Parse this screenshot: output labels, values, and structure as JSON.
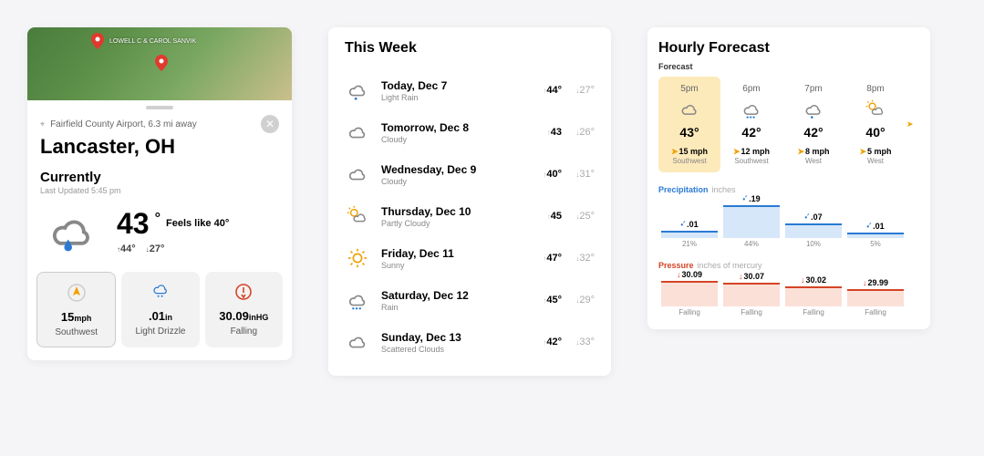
{
  "current": {
    "map_label": "LOWELL C\n& CAROL\nSANVIK",
    "station": "Fairfield County Airport, 6.3 mi away",
    "location": "Lancaster, OH",
    "section": "Currently",
    "updated": "Last Updated 5:45 pm",
    "temp": "43",
    "feels": "Feels like 40°",
    "hi": "44°",
    "lo": "27°",
    "stats": [
      {
        "value": "15",
        "unit": "mph",
        "label": "Southwest",
        "icon": "wind-arrow"
      },
      {
        "value": ".01",
        "unit": "in",
        "label": "Light Drizzle",
        "icon": "rain-cloud"
      },
      {
        "value": "30.09",
        "unit": "inHG",
        "label": "Falling",
        "icon": "pressure"
      }
    ]
  },
  "week": {
    "title": "This Week",
    "days": [
      {
        "name": "Today, Dec 7",
        "cond": "Light Rain",
        "hi": "44°",
        "lo": "27°",
        "icon": "rain-light"
      },
      {
        "name": "Tomorrow, Dec 8",
        "cond": "Cloudy",
        "hi": "43",
        "lo": "26°",
        "icon": "cloudy"
      },
      {
        "name": "Wednesday, Dec 9",
        "cond": "Cloudy",
        "hi": "40°",
        "lo": "31°",
        "icon": "cloudy"
      },
      {
        "name": "Thursday, Dec 10",
        "cond": "Partly Cloudy",
        "hi": "45",
        "lo": "25°",
        "icon": "partly"
      },
      {
        "name": "Friday, Dec 11",
        "cond": "Sunny",
        "hi": "47°",
        "lo": "32°",
        "icon": "sunny"
      },
      {
        "name": "Saturday, Dec 12",
        "cond": "Rain",
        "hi": "45°",
        "lo": "29°",
        "icon": "rain"
      },
      {
        "name": "Sunday, Dec 13",
        "cond": "Scattered Clouds",
        "hi": "42°",
        "lo": "33°",
        "icon": "cloudy"
      }
    ]
  },
  "hourly": {
    "title": "Hourly Forecast",
    "forecast_label": "Forecast",
    "precip_label": "Precipitation",
    "precip_unit": "inches",
    "pressure_label": "Pressure",
    "pressure_unit": "inches of mercury",
    "hours": [
      {
        "time": "5pm",
        "temp": "43°",
        "wind": "15 mph",
        "dir": "Southwest",
        "icon": "cloudy",
        "sel": true,
        "precip": ".01",
        "precip_h": 8,
        "precip_pct": "21%",
        "press": "30.09",
        "press_h": 28,
        "press_lab": "Falling"
      },
      {
        "time": "6pm",
        "temp": "42°",
        "wind": "12 mph",
        "dir": "Southwest",
        "icon": "rain",
        "precip": ".19",
        "precip_h": 36,
        "precip_pct": "44%",
        "press": "30.07",
        "press_h": 26,
        "press_lab": "Falling"
      },
      {
        "time": "7pm",
        "temp": "42°",
        "wind": "8 mph",
        "dir": "West",
        "icon": "rain-light",
        "precip": ".07",
        "precip_h": 16,
        "precip_pct": "10%",
        "press": "30.02",
        "press_h": 22,
        "press_lab": "Falling"
      },
      {
        "time": "8pm",
        "temp": "40°",
        "wind": "5 mph",
        "dir": "West",
        "icon": "partly",
        "precip": ".01",
        "precip_h": 6,
        "precip_pct": "5%",
        "press": "29.99",
        "press_h": 19,
        "press_lab": "Falling"
      }
    ]
  },
  "chart_data": [
    {
      "type": "bar",
      "title": "Precipitation inches",
      "categories": [
        "5pm",
        "6pm",
        "7pm",
        "8pm"
      ],
      "values": [
        0.01,
        0.19,
        0.07,
        0.01
      ],
      "secondary_pct": [
        21,
        44,
        10,
        5
      ]
    },
    {
      "type": "bar",
      "title": "Pressure inches of mercury",
      "categories": [
        "5pm",
        "6pm",
        "7pm",
        "8pm"
      ],
      "values": [
        30.09,
        30.07,
        30.02,
        29.99
      ],
      "trend": [
        "Falling",
        "Falling",
        "Falling",
        "Falling"
      ]
    }
  ]
}
